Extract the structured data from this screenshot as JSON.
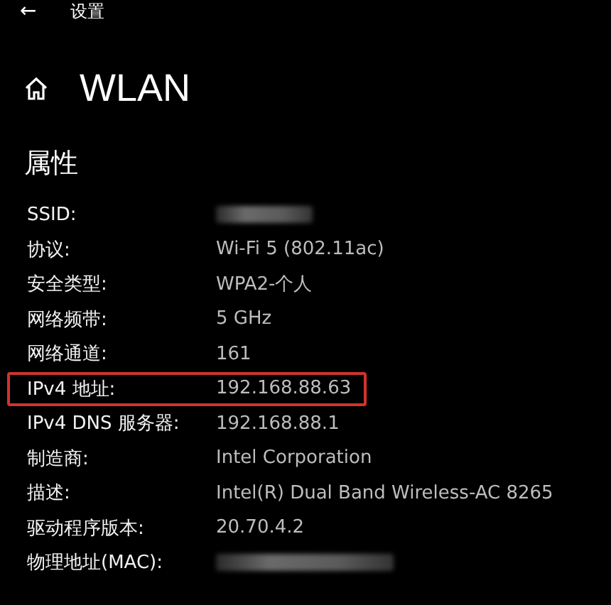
{
  "top_bar": {
    "back": "←",
    "title": "设置"
  },
  "page": {
    "title": "WLAN"
  },
  "section": {
    "title": "属性"
  },
  "properties": [
    {
      "label": "SSID:",
      "kind": "redacted",
      "highlighted": false
    },
    {
      "label": "协议:",
      "value": "Wi-Fi 5 (802.11ac)",
      "kind": "text",
      "highlighted": false
    },
    {
      "label": "安全类型:",
      "value": "WPA2-个人",
      "kind": "text",
      "highlighted": false
    },
    {
      "label": "网络频带:",
      "value": "5 GHz",
      "kind": "text",
      "highlighted": false
    },
    {
      "label": "网络通道:",
      "value": "161",
      "kind": "text",
      "highlighted": false
    },
    {
      "label": "IPv4 地址:",
      "value": "192.168.88.63",
      "kind": "text",
      "highlighted": true
    },
    {
      "label": "IPv4 DNS 服务器:",
      "value": "192.168.88.1",
      "kind": "text",
      "highlighted": false
    },
    {
      "label": "制造商:",
      "value": "Intel Corporation",
      "kind": "text",
      "highlighted": false
    },
    {
      "label": "描述:",
      "value": "Intel(R) Dual Band Wireless-AC 8265",
      "kind": "text",
      "highlighted": false
    },
    {
      "label": "驱动程序版本:",
      "value": "20.70.4.2",
      "kind": "text",
      "highlighted": false
    },
    {
      "label": "物理地址(MAC):",
      "kind": "redacted",
      "highlighted": false
    }
  ]
}
